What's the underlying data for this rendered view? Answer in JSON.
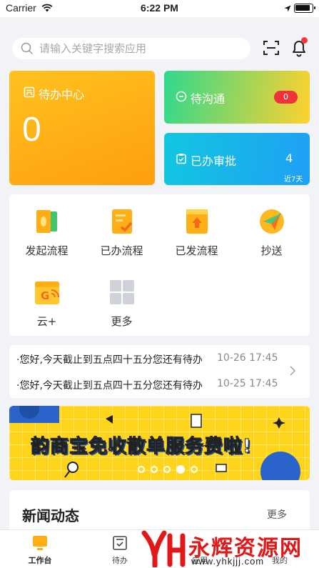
{
  "status_bar": {
    "carrier": "Carrier",
    "time": "6:22 PM"
  },
  "search": {
    "placeholder": "请输入关键字搜索应用"
  },
  "cards": {
    "todo": {
      "title": "待办中心",
      "count": "0"
    },
    "communicate": {
      "title": "待沟通",
      "badge": "0"
    },
    "approved": {
      "title": "已办审批",
      "count": "4",
      "sub": "近7天"
    }
  },
  "apps": [
    {
      "label": "发起流程",
      "icon": "start-process-icon"
    },
    {
      "label": "已办流程",
      "icon": "done-process-icon"
    },
    {
      "label": "已发流程",
      "icon": "sent-process-icon"
    },
    {
      "label": "抄送",
      "icon": "cc-paper-plane-icon"
    },
    {
      "label": "云+",
      "icon": "cloud-plus-icon"
    },
    {
      "label": "更多",
      "icon": "more-grid-icon"
    }
  ],
  "messages": [
    {
      "text": "·您好,今天截止到五点四十五分您还有待办",
      "time": "10-26 17:45"
    },
    {
      "text": "·您好,今天截止到五点四十五分您还有待办",
      "time": "10-25 17:45"
    }
  ],
  "banner": {
    "text": "韵商宝免收散单服务费啦!"
  },
  "news": {
    "title": "新闻动态",
    "more": "更多"
  },
  "tabbar": [
    {
      "label": "工作台",
      "icon": "workbench-icon",
      "active": true
    },
    {
      "label": "待办",
      "icon": "todo-check-icon",
      "active": false
    },
    {
      "label": "应用",
      "icon": "apps-icon",
      "active": false
    },
    {
      "label": "我的",
      "icon": "profile-icon",
      "active": false
    }
  ],
  "watermark": {
    "text": "永辉资源网",
    "url": "www.yhkjjj.com"
  },
  "colors": {
    "accent_orange": "#ffae15",
    "badge_red": "#f0333a",
    "banner_yellow": "#ffd51c"
  }
}
